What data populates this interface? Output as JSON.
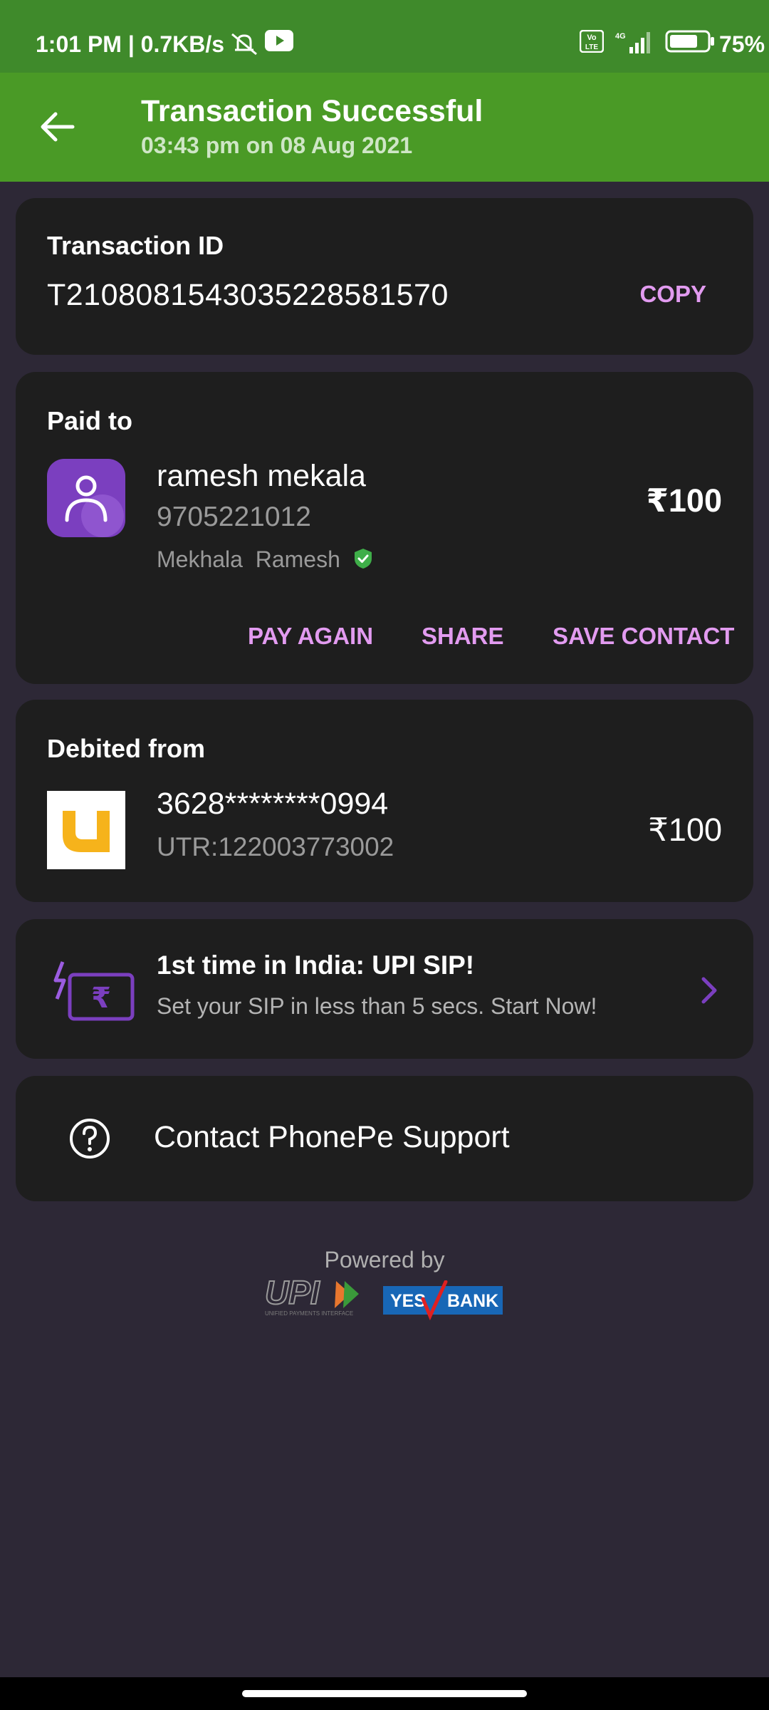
{
  "status_bar": {
    "time_and_speed": "1:01 PM | 0.7KB/s",
    "battery_percent": "75%",
    "network": "4G"
  },
  "header": {
    "title": "Transaction Successful",
    "subtitle": "03:43 pm on 08 Aug 2021"
  },
  "transaction": {
    "label": "Transaction ID",
    "id": "T2108081543035228581570",
    "copy_label": "COPY"
  },
  "paid_to": {
    "label": "Paid to",
    "name": "ramesh mekala",
    "phone": "9705221012",
    "bank_name": "Mekhala  Ramesh",
    "amount": "₹100",
    "actions": {
      "pay_again": "PAY AGAIN",
      "share": "SHARE",
      "save_contact": "SAVE CONTACT"
    }
  },
  "debited_from": {
    "label": "Debited from",
    "account": "3628********0994",
    "utr": "UTR:122003773002",
    "amount": "₹100"
  },
  "promo": {
    "title": "1st time in India: UPI SIP!",
    "subtitle": "Set your SIP in less than 5 secs. Start Now!"
  },
  "support": {
    "label": "Contact PhonePe Support"
  },
  "footer": {
    "powered_by": "Powered by",
    "upi_text": "UPI",
    "upi_tagline": "UNIFIED PAYMENTS INTERFACE",
    "bank_yes": "YES",
    "bank_bank": "BANK"
  },
  "colors": {
    "accent": "#e29bf0",
    "header_green": "#4a9a26",
    "card_bg": "#1e1e1e",
    "page_bg": "#2d2836"
  }
}
